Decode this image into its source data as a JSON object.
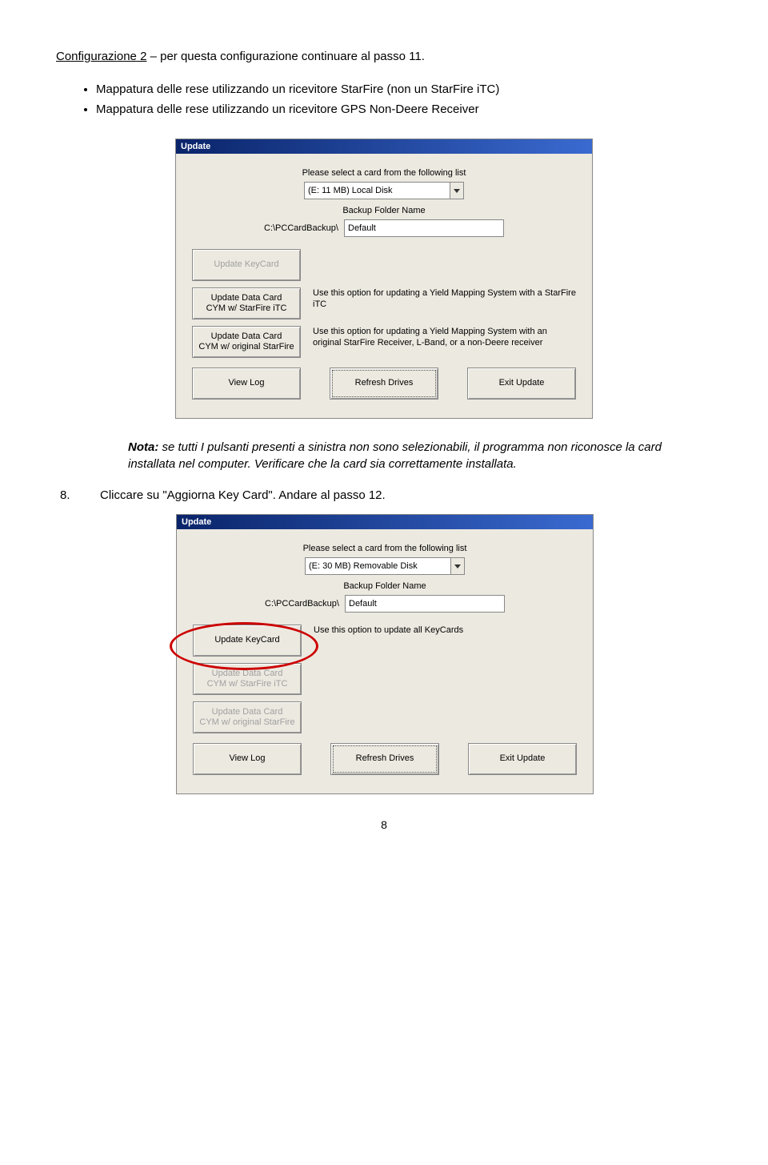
{
  "config_line": {
    "underlined": "Configurazione 2",
    "rest": " – per questa configurazione continuare al passo 11."
  },
  "bullets": [
    "Mappatura delle rese utilizzando un ricevitore StarFire (non un StarFire iTC)",
    "Mappatura delle rese utilizzando un ricevitore GPS Non-Deere Receiver"
  ],
  "dialog1": {
    "title": "Update",
    "select_label": "Please select a card from the following list",
    "combo_value": "(E: 11 MB) Local Disk",
    "backup_label": "Backup Folder Name",
    "backup_prefix": "C:\\PCCardBackup\\",
    "backup_value": "Default",
    "btn_keycard": "Update KeyCard",
    "btn_itc": "Update Data Card\nCYM w/ StarFire iTC",
    "desc_itc": "Use this option for updating a Yield Mapping System with a StarFire iTC",
    "btn_orig": "Update Data Card\nCYM w/ original StarFire",
    "desc_orig": "Use this option for updating a Yield Mapping System with an original StarFire Receiver, L-Band, or a non-Deere receiver",
    "btn_view": "View Log",
    "btn_refresh": "Refresh Drives",
    "btn_exit": "Exit Update"
  },
  "note": {
    "label": "Nota:",
    "text": " se tutti I pulsanti presenti a sinistra non sono selezionabili, il programma non riconosce la card installata nel computer. Verificare che la card sia correttamente installata."
  },
  "step8": {
    "num": "8.",
    "text": "Cliccare su \"Aggiorna Key Card\". Andare al passo 12."
  },
  "dialog2": {
    "title": "Update",
    "select_label": "Please select a card from the following list",
    "combo_value": "(E: 30 MB) Removable Disk",
    "backup_label": "Backup Folder Name",
    "backup_prefix": "C:\\PCCardBackup\\",
    "backup_value": "Default",
    "btn_keycard": "Update KeyCard",
    "desc_keycard": "Use this option to update all KeyCards",
    "btn_itc": "Update Data Card\nCYM w/ StarFire iTC",
    "btn_orig": "Update Data Card\nCYM w/ original StarFire",
    "btn_view": "View Log",
    "btn_refresh": "Refresh Drives",
    "btn_exit": "Exit Update"
  },
  "page_number": "8"
}
